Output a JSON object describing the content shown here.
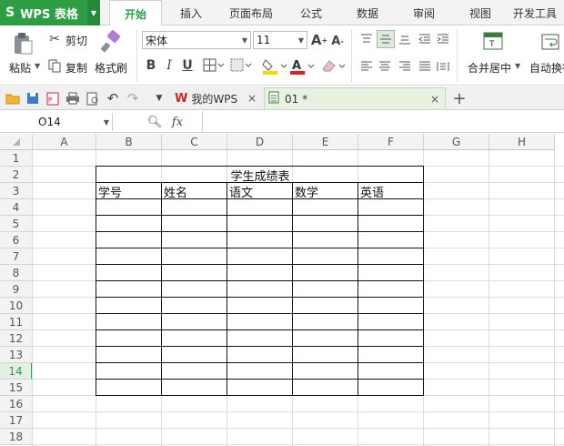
{
  "app": {
    "logo": "S",
    "name": "WPS 表格"
  },
  "tabs": [
    {
      "label": "开始",
      "active": true
    },
    {
      "label": "插入"
    },
    {
      "label": "页面布局"
    },
    {
      "label": "公式"
    },
    {
      "label": "数据"
    },
    {
      "label": "审阅"
    },
    {
      "label": "视图"
    },
    {
      "label": "开发工具"
    }
  ],
  "ribbon": {
    "paste": "粘贴",
    "cut": "剪切",
    "copy": "复制",
    "format_painter": "格式刷",
    "font_name": "宋体",
    "font_size": "11",
    "merge_center": "合并居中",
    "auto_wrap": "自动换行"
  },
  "doc_tabs": [
    {
      "label": "我的WPS"
    },
    {
      "label": "01 *"
    }
  ],
  "formula_bar": {
    "cell_ref": "O14",
    "fx": "fx",
    "value": ""
  },
  "columns": [
    "A",
    "B",
    "C",
    "D",
    "E",
    "F",
    "G",
    "H"
  ],
  "rows": [
    "1",
    "2",
    "3",
    "4",
    "5",
    "6",
    "7",
    "8",
    "9",
    "10",
    "11",
    "12",
    "13",
    "14",
    "15",
    "16",
    "17",
    "18"
  ],
  "selected_row": "14",
  "sheet": {
    "title": "学生成绩表",
    "headers": [
      "学号",
      "姓名",
      "语文",
      "数学",
      "英语"
    ]
  }
}
